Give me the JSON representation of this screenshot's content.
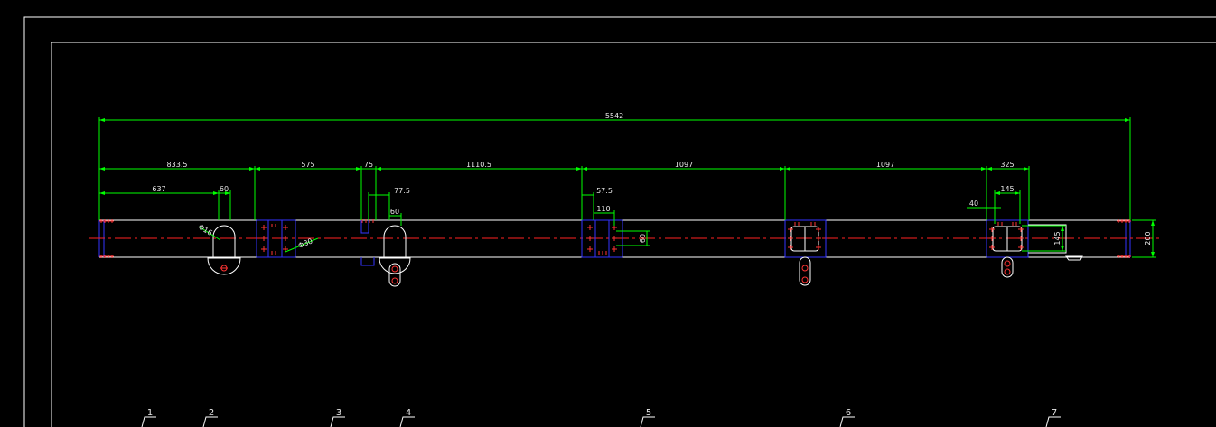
{
  "drawing": {
    "overall_dimension": "5542",
    "chain_dimensions": [
      "833.5",
      "575",
      "75",
      "1110.5",
      "1097",
      "1097",
      "325"
    ],
    "detail_dimensions": {
      "d637": "637",
      "d60a": "60",
      "d60b": "60",
      "d77_5": "77.5",
      "d57_5": "57.5",
      "d110": "110",
      "d60c": "60",
      "d145": "145",
      "d40": "40",
      "d145v": "145",
      "d200": "200",
      "phi16": "Φ16",
      "phi30": "Φ30"
    },
    "callouts": [
      "1",
      "2",
      "3",
      "4",
      "5",
      "6",
      "7"
    ],
    "colors": {
      "background": "#000000",
      "frame": "#ffffff",
      "dimension": "#00ff00",
      "centerline": "#ff0000",
      "plate": "#3333ff",
      "bolt": "#ff3333",
      "text": "#e8e8e8"
    }
  }
}
